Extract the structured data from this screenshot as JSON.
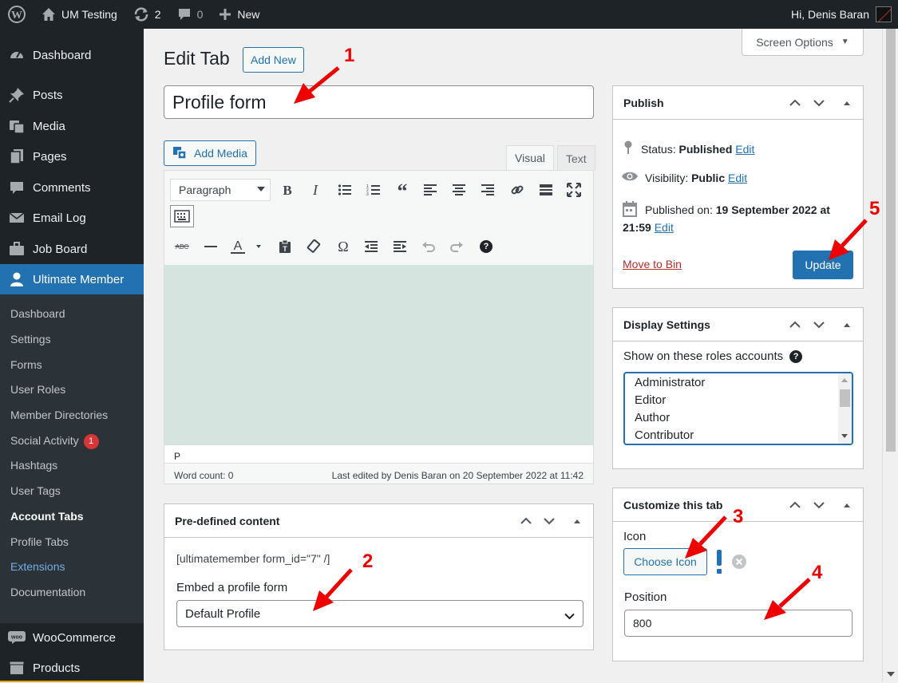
{
  "admin_bar": {
    "site_name": "UM Testing",
    "updates_count": "2",
    "comments_count": "0",
    "new_label": "New",
    "greeting": "Hi, Denis Baran"
  },
  "sidebar": {
    "top_items": [
      {
        "label": "Dashboard",
        "icon": "dashboard-icon"
      },
      {
        "label": "Posts",
        "icon": "pin-icon"
      },
      {
        "label": "Media",
        "icon": "media-icon"
      },
      {
        "label": "Pages",
        "icon": "pages-icon"
      },
      {
        "label": "Comments",
        "icon": "comments-icon"
      },
      {
        "label": "Email Log",
        "icon": "email-icon"
      },
      {
        "label": "Job Board",
        "icon": "briefcase-icon"
      },
      {
        "label": "Ultimate Member",
        "icon": "user-icon"
      }
    ],
    "submenu": [
      {
        "label": "Dashboard"
      },
      {
        "label": "Settings"
      },
      {
        "label": "Forms"
      },
      {
        "label": "User Roles"
      },
      {
        "label": "Member Directories"
      },
      {
        "label": "Social Activity",
        "badge": "1"
      },
      {
        "label": "Hashtags"
      },
      {
        "label": "User Tags"
      },
      {
        "label": "Account Tabs"
      },
      {
        "label": "Profile Tabs"
      },
      {
        "label": "Extensions"
      },
      {
        "label": "Documentation"
      }
    ],
    "bottom_items": [
      {
        "label": "WooCommerce",
        "icon": "woo-icon"
      },
      {
        "label": "Products",
        "icon": "box-icon"
      }
    ]
  },
  "screen_options": "Screen Options",
  "page": {
    "title": "Edit Tab",
    "add_new": "Add New",
    "post_title": "Profile form"
  },
  "editor": {
    "add_media": "Add Media",
    "tab_visual": "Visual",
    "tab_text": "Text",
    "format": "Paragraph",
    "path": "P",
    "word_count": "Word count: 0",
    "last_edited": "Last edited by Denis Baran on 20 September 2022 at 11:42",
    "content_bg": "#d6e4df"
  },
  "predefined": {
    "title": "Pre-defined content",
    "shortcode": "[ultimatemember form_id=\"7\" /]",
    "embed_label": "Embed a profile form",
    "embed_value": "Default Profile"
  },
  "publish": {
    "title": "Publish",
    "status_label": "Status:",
    "status_value": "Published",
    "visibility_label": "Visibility:",
    "visibility_value": "Public",
    "edit": "Edit",
    "published_label": "Published on:",
    "published_value_1": "19 September 2022 at",
    "published_value_2": "21:59",
    "move_to_bin": "Move to Bin",
    "update": "Update"
  },
  "display_settings": {
    "title": "Display Settings",
    "roles_label": "Show on these roles accounts",
    "roles": [
      "Administrator",
      "Editor",
      "Author",
      "Contributor"
    ]
  },
  "customize": {
    "title": "Customize this tab",
    "icon_label": "Icon",
    "choose_icon": "Choose Icon",
    "position_label": "Position",
    "position_value": "800"
  },
  "annotations": [
    "1",
    "2",
    "3",
    "4",
    "5"
  ],
  "colors": {
    "accent": "#2271b1",
    "admin_dark": "#1d2327",
    "annotation": "#ee0000"
  }
}
